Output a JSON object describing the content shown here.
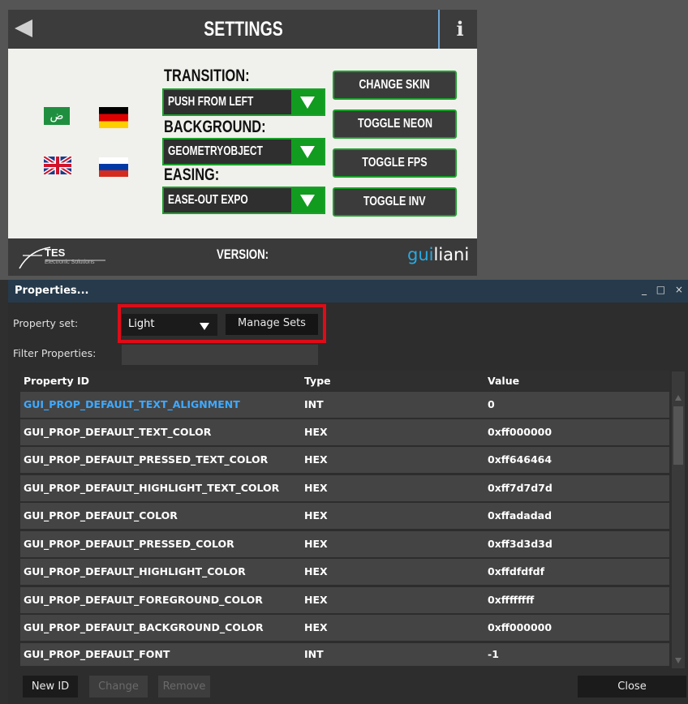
{
  "app": {
    "title": "SETTINGS",
    "info_icon": "i",
    "transition_label": "TRANSITION:",
    "transition_value": "PUSH FROM LEFT",
    "background_label": "BACKGROUND:",
    "background_value": "GEOMETRYOBJECT",
    "easing_label": "EASING:",
    "easing_value": "EASE-OUT EXPO",
    "buttons": [
      "CHANGE SKIN",
      "TOGGLE NEON",
      "TOGGLE FPS",
      "TOGGLE INV"
    ],
    "flags": [
      "arabic-flag-icon",
      "german-flag-icon",
      "uk-flag-icon",
      "russian-flag-icon"
    ],
    "arabic_glyph": "ض",
    "version_label": "VERSION:",
    "tes_name": "TES",
    "tes_sub": "Electronic Solutions",
    "guiliani_accent": "gui",
    "guiliani_rest": "liani",
    "colors": {
      "accent_green": "#119b1f",
      "panel_bg": "#f0f1ec",
      "highlight_red": "#e00b17",
      "selected_blue": "#3fa9ff"
    }
  },
  "properties": {
    "title": "Properties...",
    "window_controls": "_ □ ×",
    "property_set_label": "Property set:",
    "property_set_value": "Light",
    "manage_sets_label": "Manage Sets",
    "filter_label": "Filter Properties:",
    "filter_value": "",
    "columns": [
      "Property ID",
      "Type",
      "Value"
    ],
    "rows": [
      [
        "GUI_PROP_DEFAULT_TEXT_ALIGNMENT",
        "INT",
        "0"
      ],
      [
        "GUI_PROP_DEFAULT_TEXT_COLOR",
        "HEX",
        "0xff000000"
      ],
      [
        "GUI_PROP_DEFAULT_PRESSED_TEXT_COLOR",
        "HEX",
        "0xff646464"
      ],
      [
        "GUI_PROP_DEFAULT_HIGHLIGHT_TEXT_COLOR",
        "HEX",
        "0xff7d7d7d"
      ],
      [
        "GUI_PROP_DEFAULT_COLOR",
        "HEX",
        "0xffadadad"
      ],
      [
        "GUI_PROP_DEFAULT_PRESSED_COLOR",
        "HEX",
        "0xff3d3d3d"
      ],
      [
        "GUI_PROP_DEFAULT_HIGHLIGHT_COLOR",
        "HEX",
        "0xffdfdfdf"
      ],
      [
        "GUI_PROP_DEFAULT_FOREGROUND_COLOR",
        "HEX",
        "0xffffffff"
      ],
      [
        "GUI_PROP_DEFAULT_BACKGROUND_COLOR",
        "HEX",
        "0xff000000"
      ],
      [
        "GUI_PROP_DEFAULT_FONT",
        "INT",
        "-1"
      ]
    ],
    "new_id_label": "New ID",
    "change_label": "Change",
    "remove_label": "Remove",
    "close_label": "Close"
  }
}
